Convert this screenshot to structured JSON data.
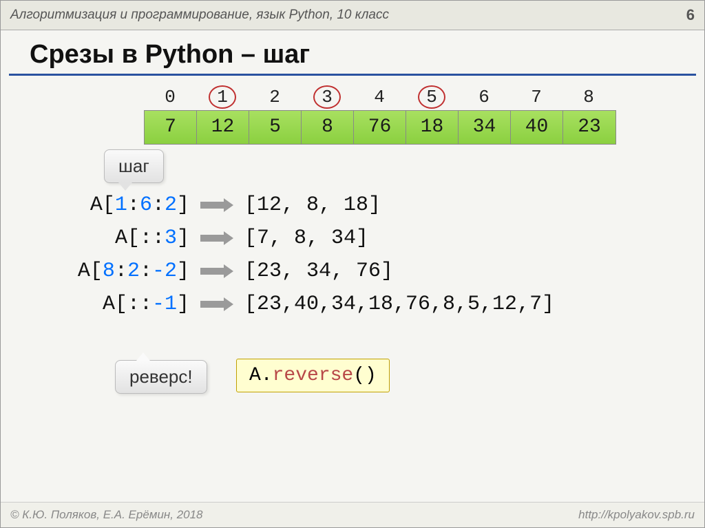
{
  "header": {
    "title": "Алгоритмизация и программирование, язык Python, 10 класс",
    "page": "6"
  },
  "slide_title": "Срезы в Python – шаг",
  "array": {
    "indices": [
      "0",
      "1",
      "2",
      "3",
      "4",
      "5",
      "6",
      "7",
      "8"
    ],
    "circled": [
      1,
      3,
      5
    ],
    "values": [
      "7",
      "12",
      "5",
      "8",
      "76",
      "18",
      "34",
      "40",
      "23"
    ]
  },
  "callouts": {
    "shag": "шаг",
    "reverse": "реверс!"
  },
  "examples": [
    {
      "prefix": "A[",
      "args": [
        "1",
        ":",
        "6",
        ":",
        "2"
      ],
      "suffix": "]",
      "result": "[12, 8, 18]"
    },
    {
      "prefix": "A[",
      "args": [
        ":",
        ":",
        "3"
      ],
      "suffix": "]",
      "result": "[7, 8, 34]"
    },
    {
      "prefix": "A[",
      "args": [
        "8",
        ":",
        "2",
        ":",
        "-2"
      ],
      "suffix": "]",
      "result": "[23, 34, 76]"
    },
    {
      "prefix": "A[",
      "args": [
        ":",
        ":",
        "-1"
      ],
      "suffix": "]",
      "result": "[23,40,34,18,76,8,5,12,7]"
    }
  ],
  "reverse_code": {
    "obj": "A.",
    "func": "reverse",
    "rest": "()"
  },
  "footer": {
    "left": "© К.Ю. Поляков, Е.А. Ерёмин, 2018",
    "right": "http://kpolyakov.spb.ru"
  }
}
